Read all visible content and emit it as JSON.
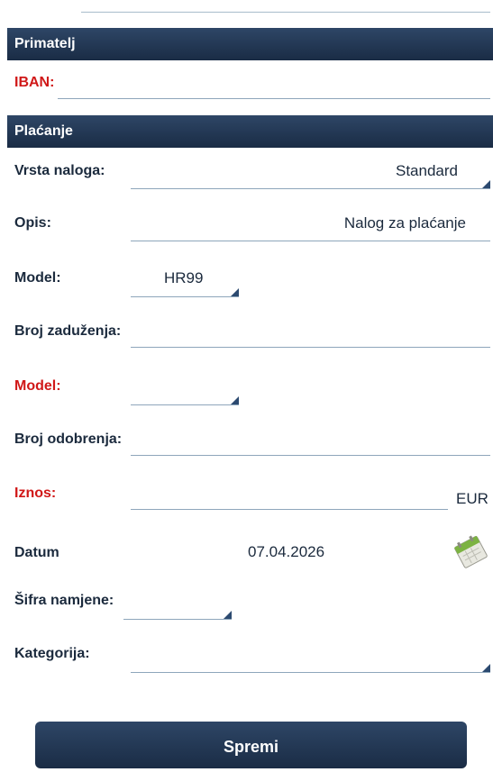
{
  "sections": {
    "primatelj": "Primatelj",
    "placanje": "Plaćanje"
  },
  "fields": {
    "iban_label": "IBAN:",
    "vrsta_label": "Vrsta naloga:",
    "vrsta_value": "Standard",
    "opis_label": "Opis:",
    "opis_value": "Nalog za plaćanje",
    "model1_label": "Model:",
    "model1_value": "HR99",
    "broj_zaduzenja_label": "Broj zaduženja:",
    "model2_label": "Model:",
    "broj_odobrenja_label": "Broj odobrenja:",
    "iznos_label": "Iznos:",
    "currency": "EUR",
    "datum_label": "Datum",
    "datum_value": "07.04.2026",
    "sifra_label": "Šifra namjene:",
    "kategorija_label": "Kategorija:"
  },
  "actions": {
    "save_label": "Spremi"
  },
  "colors": {
    "header_bg": "#1f3350",
    "required_label": "#d01818",
    "underline": "#8ea6bb"
  },
  "icons": {
    "calendar": "calendar-icon",
    "dropdown": "dropdown-triangle-icon"
  }
}
